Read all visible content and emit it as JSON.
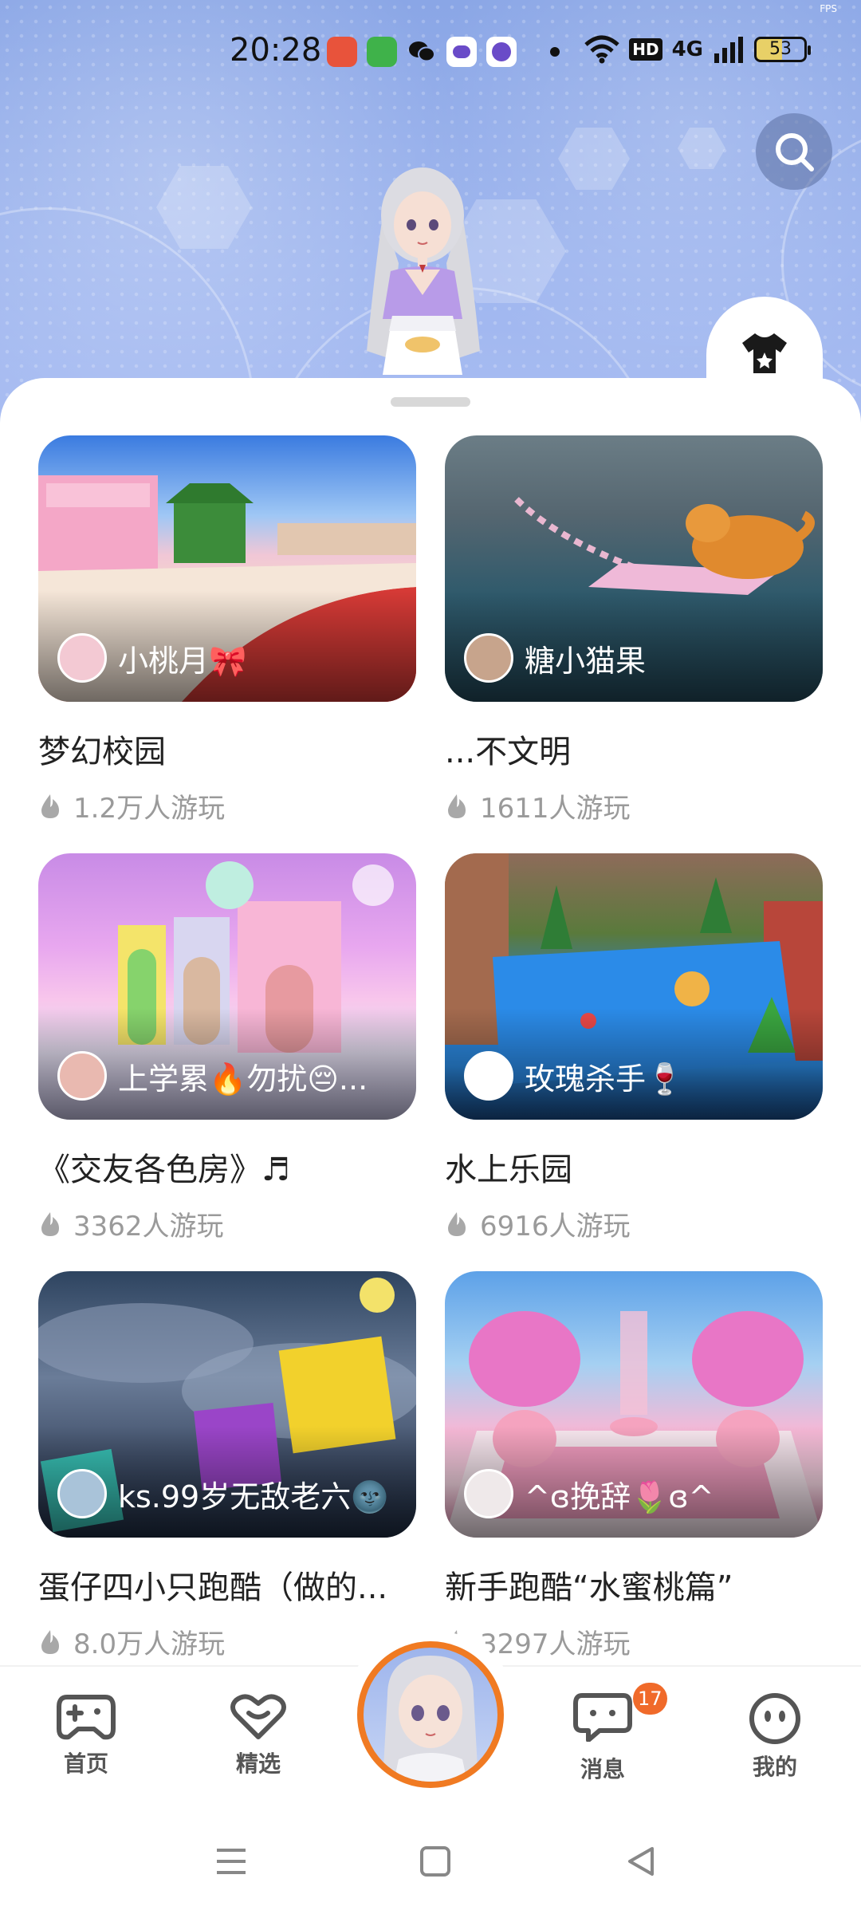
{
  "status_bar": {
    "time": "20:28",
    "network": "4G",
    "hd_label": "HD",
    "battery": "53",
    "fps_label": "FPS"
  },
  "header": {
    "search_icon": "search-icon",
    "wardrobe_icon": "tshirt-icon"
  },
  "games": [
    {
      "title": "梦幻校园",
      "author": "小桃月🎀",
      "plays": "1.2万人游玩",
      "avatar_color": "#f3c9d3"
    },
    {
      "title": "...不文明",
      "author": "糖小猫果",
      "plays": "1611人游玩",
      "avatar_color": "#c7a48c"
    },
    {
      "title": "《交友各色房》♬",
      "author": "上学累🔥勿扰😔...",
      "plays": "3362人游玩",
      "avatar_color": "#e9b9b0"
    },
    {
      "title": "水上乐园",
      "author": "玫瑰杀手🍷",
      "plays": "6916人游玩",
      "avatar_color": "#ffffff"
    },
    {
      "title": "蛋仔四小只跑酷（做的...",
      "author": "ks.99岁无敌老六🌚",
      "plays": "8.0万人游玩",
      "avatar_color": "#a9c3d9"
    },
    {
      "title": "新手跑酷“水蜜桃篇”",
      "author": "^ɞ挽辞🌷ɞ^",
      "plays": "3297人游玩",
      "avatar_color": "#efe9ea"
    }
  ],
  "nav": {
    "home": "首页",
    "featured": "精选",
    "messages": "消息",
    "messages_badge": "17",
    "me": "我的"
  },
  "colors": {
    "accent": "#f07a22",
    "badge": "#f06a2a",
    "banner": "#8fa9e8"
  }
}
